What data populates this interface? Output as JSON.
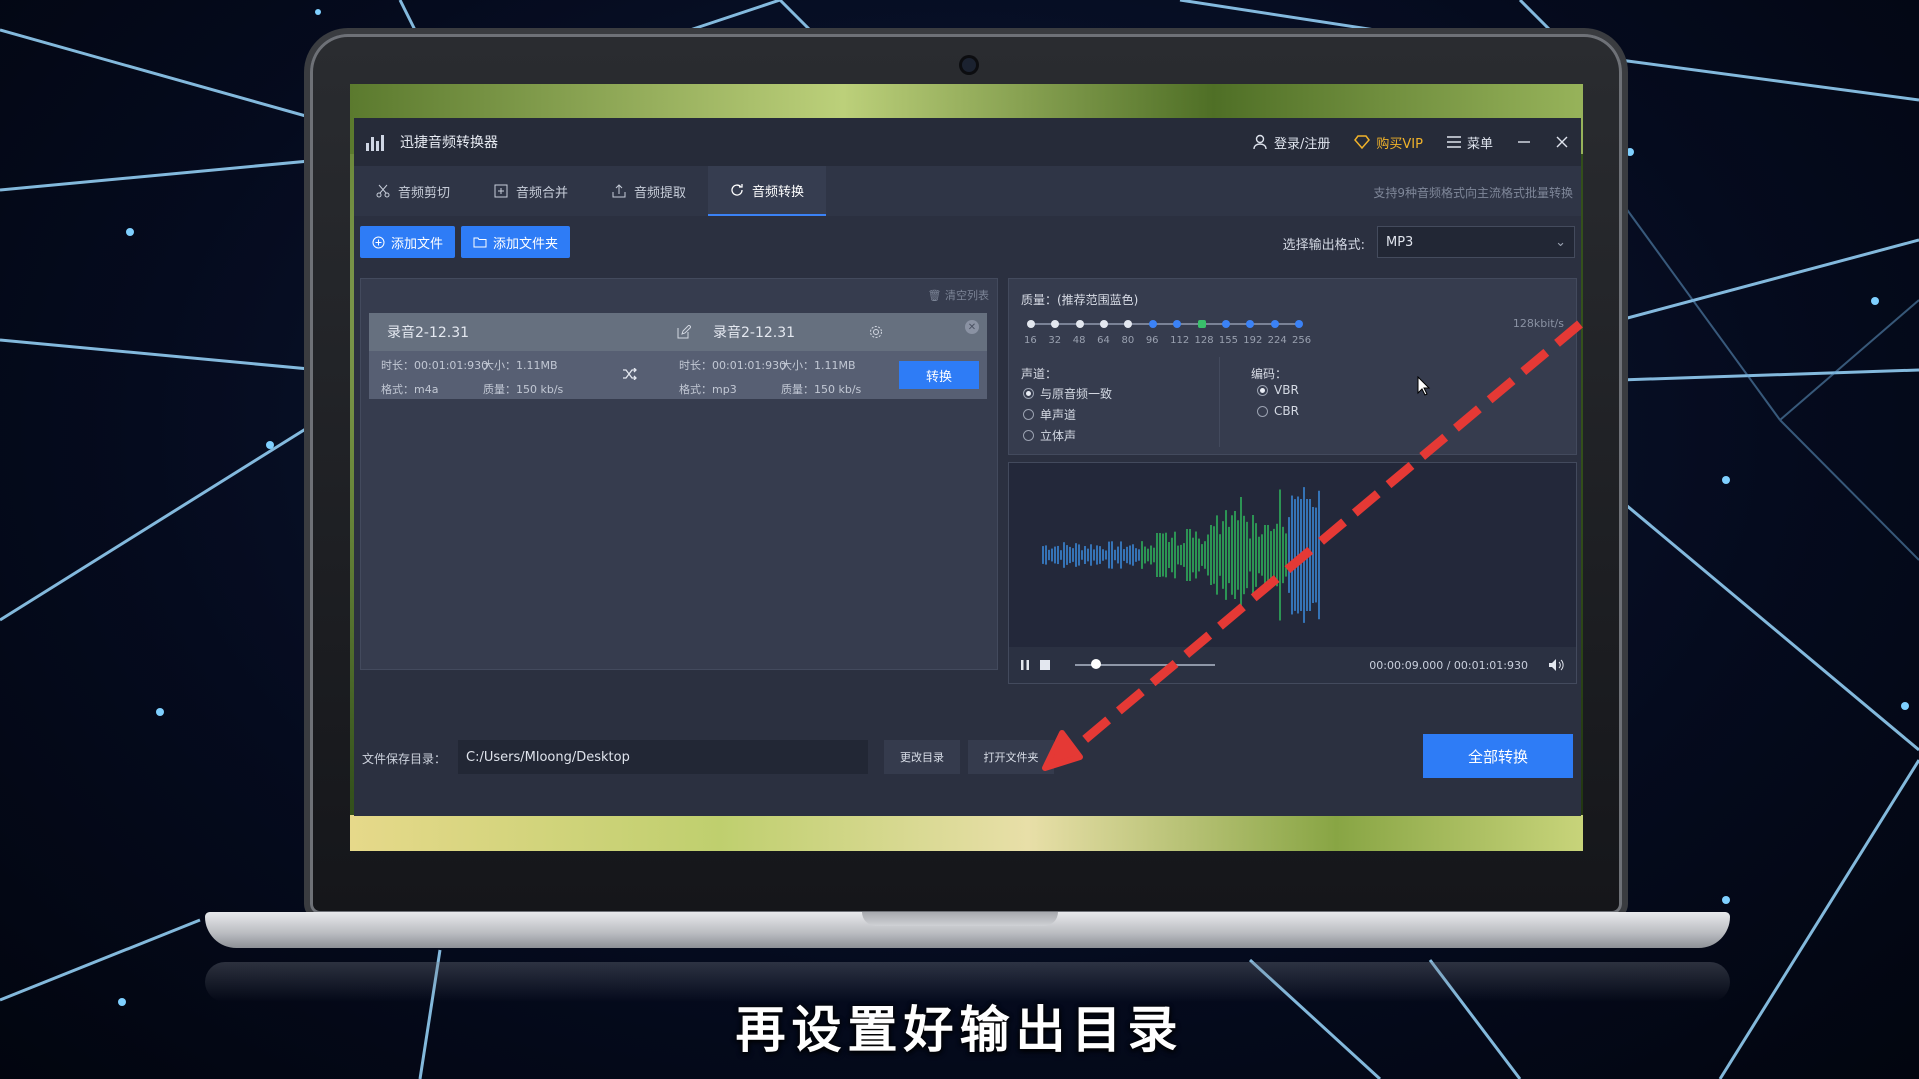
{
  "app": {
    "title": "迅捷音频转换器",
    "login": "登录/注册",
    "vip": "购买VIP",
    "menu": "菜单"
  },
  "tabs": [
    {
      "label": "音频剪切",
      "icon": "scissors-icon"
    },
    {
      "label": "音频合并",
      "icon": "merge-icon"
    },
    {
      "label": "音频提取",
      "icon": "extract-icon"
    },
    {
      "label": "音频转换",
      "icon": "refresh-icon",
      "active": true
    }
  ],
  "tab_hint": "支持9种音频格式向主流格式批量转换",
  "toolbar": {
    "add_file": "添加文件",
    "add_folder": "添加文件夹",
    "format_label": "选择输出格式:",
    "format_value": "MP3"
  },
  "file_list": {
    "clear": "清空列表",
    "item": {
      "source_name": "录音2-12.31",
      "target_name": "录音2-12.31",
      "source_duration": "时长：00:01:01:930",
      "source_size": "大小：1.11MB",
      "source_format": "格式：m4a",
      "source_quality": "质量：150 kb/s",
      "target_duration": "时长：00:01:01:930",
      "target_size": "大小：1.11MB",
      "target_format": "格式：mp3",
      "target_quality": "质量：150 kb/s",
      "convert": "转换"
    }
  },
  "settings": {
    "quality_label": "质量：(推荐范围蓝色)",
    "quality_ticks": [
      "16",
      "32",
      "48",
      "64",
      "80",
      "96",
      "112",
      "128",
      "155",
      "192",
      "224",
      "256"
    ],
    "quality_value": "128kbit/s",
    "channel_label": "声道：",
    "channel_options": [
      "与原音频一致",
      "单声道",
      "立体声"
    ],
    "encoding_label": "编码：",
    "encoding_options": [
      "VBR",
      "CBR"
    ]
  },
  "player": {
    "time": "00:00:09.000 / 00:01:01:930"
  },
  "bottom": {
    "save_label": "文件保存目录：",
    "save_path": "C:/Users/Mloong/Desktop",
    "change_dir": "更改目录",
    "open_folder": "打开文件夹",
    "convert_all": "全部转换"
  },
  "subtitle": "再设置好输出目录",
  "colors": {
    "accent": "#2e7cf6",
    "vip": "#f0b22a",
    "arrow": "#e53935"
  }
}
